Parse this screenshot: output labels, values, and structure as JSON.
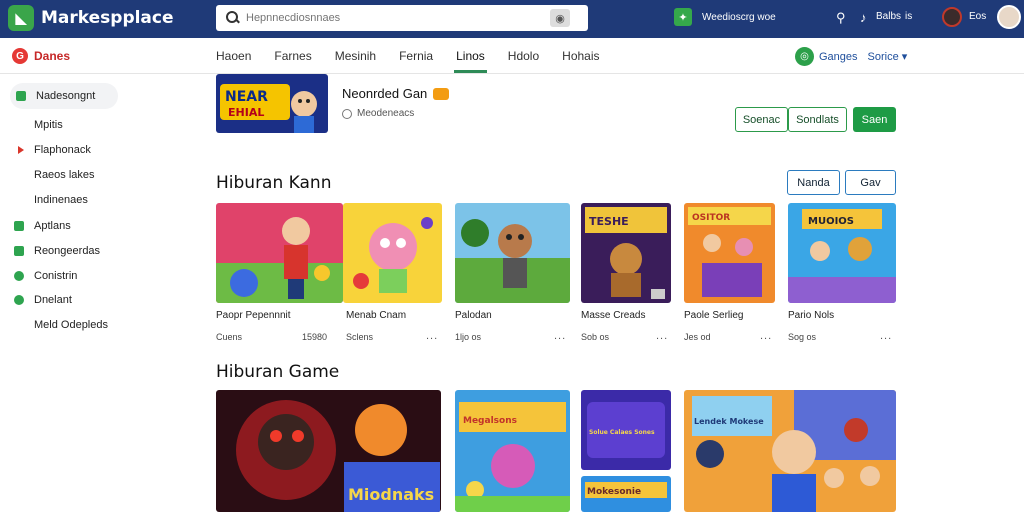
{
  "header": {
    "logo_text": "Markespplace",
    "search_placeholder": "Hepnnecdiosnnaes",
    "account_label": "Weedioscrg woe",
    "links": [
      "Balbs",
      "Eos"
    ],
    "colors": {
      "bar": "#1f3a78",
      "accent": "#35a84b"
    }
  },
  "subnav": {
    "brand": "Danes",
    "tabs": [
      "Haoen",
      "Farnes",
      "Mesinih",
      "Fernia",
      "Linos",
      "Hdolo",
      "Hohais"
    ],
    "active_tab_index": 4,
    "right_label": "Ganges",
    "right_dropdown": "Sorice"
  },
  "sidebar": {
    "items": [
      {
        "label": "Nadesongnt",
        "icon": "square-check-icon"
      },
      {
        "label": "Mpitis",
        "icon": "none"
      },
      {
        "label": "Flaphonack",
        "icon": "triangle-icon"
      },
      {
        "label": "Raeos lakes",
        "icon": "none"
      },
      {
        "label": "Indinenaes",
        "icon": "none"
      },
      {
        "label": "Aptlans",
        "icon": "square-icon"
      },
      {
        "label": "Reongeerdas",
        "icon": "square-check-icon"
      },
      {
        "label": "Conistrin",
        "icon": "circle-icon"
      },
      {
        "label": "Dnelant",
        "icon": "circle-icon"
      },
      {
        "label": "Meld Odepleds",
        "icon": "none"
      }
    ]
  },
  "featured": {
    "title": "Neonrded Gan",
    "meta": "Meodeneacs",
    "buttons": [
      "Soenac",
      "Sondlats",
      "Saen"
    ]
  },
  "section1": {
    "title": "Hiburan Kann",
    "buttons": [
      "Nanda",
      "Gav"
    ],
    "cards": [
      {
        "name": "Paopr Pepennnit",
        "meta": "Cuens",
        "meta2": "15980",
        "more": "..."
      },
      {
        "name": "Menab Cnam",
        "meta": "Sclens",
        "more": "..."
      },
      {
        "name": "Palodan",
        "meta": "1ljo os",
        "more": "..."
      },
      {
        "name": "Masse Creads",
        "meta": "Sob os",
        "more": "..."
      },
      {
        "name": "Paole Serlieg",
        "meta": "Jes od",
        "more": "..."
      },
      {
        "name": "Pario Nols",
        "meta": "Sog os",
        "more": "..."
      }
    ]
  },
  "section2": {
    "title": "Hiburan Game",
    "cards": [
      "Miodnaks",
      "Megalsons",
      "Solue Calaes Sones",
      "Mokesonie",
      "Lendek Mokese"
    ]
  }
}
